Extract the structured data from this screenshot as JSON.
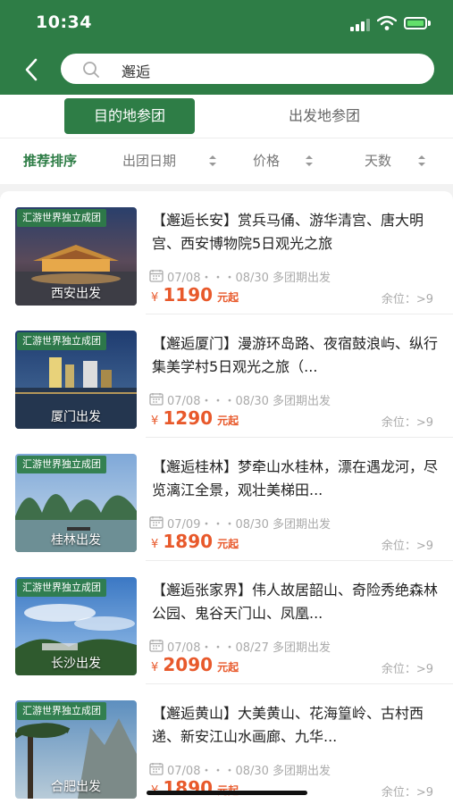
{
  "status_bar": {
    "time": "10:34"
  },
  "search": {
    "query": "邂逅"
  },
  "tabs": [
    {
      "label": "目的地参团",
      "active": true
    },
    {
      "label": "出发地参团",
      "active": false
    }
  ],
  "sort": [
    {
      "label": "推荐排序",
      "active": true
    },
    {
      "label": "出团日期"
    },
    {
      "label": "价格"
    },
    {
      "label": "天数"
    }
  ],
  "colors": {
    "brand": "#2e7d46",
    "price": "#e8592b"
  },
  "products": [
    {
      "badge": "汇游世界独立成团",
      "city": "西安出发",
      "title": "【邂逅长安】赏兵马俑、游华清宫、唐大明宫、西安博物院5日观光之旅",
      "dates": "07/08・・・08/30 多团期出发",
      "yen": "¥",
      "price": "1190",
      "unit": "元起",
      "seats": "余位：>9"
    },
    {
      "badge": "汇游世界独立成团",
      "city": "厦门出发",
      "title": "【邂逅厦门】漫游环岛路、夜宿鼓浪屿、纵行集美学村5日观光之旅（...",
      "dates": "07/08・・・08/30 多团期出发",
      "yen": "¥",
      "price": "1290",
      "unit": "元起",
      "seats": "余位：>9"
    },
    {
      "badge": "汇游世界独立成团",
      "city": "桂林出发",
      "title": "【邂逅桂林】梦牵山水桂林，漂在遇龙河，尽览漓江全景，观壮美梯田...",
      "dates": "07/09・・・08/30 多团期出发",
      "yen": "¥",
      "price": "1890",
      "unit": "元起",
      "seats": "余位：>9"
    },
    {
      "badge": "汇游世界独立成团",
      "city": "长沙出发",
      "title": "【邂逅张家界】伟人故居韶山、奇险秀绝森林公园、鬼谷天门山、凤凰...",
      "dates": "07/08・・・08/27 多团期出发",
      "yen": "¥",
      "price": "2090",
      "unit": "元起",
      "seats": "余位：>9"
    },
    {
      "badge": "汇游世界独立成团",
      "city": "合肥出发",
      "title": "【邂逅黄山】大美黄山、花海篁岭、古村西递、新安江山水画廊、九华...",
      "dates": "07/08・・・08/30 多团期出发",
      "yen": "¥",
      "price": "1890",
      "unit": "元起",
      "seats": "余位：>9"
    }
  ]
}
